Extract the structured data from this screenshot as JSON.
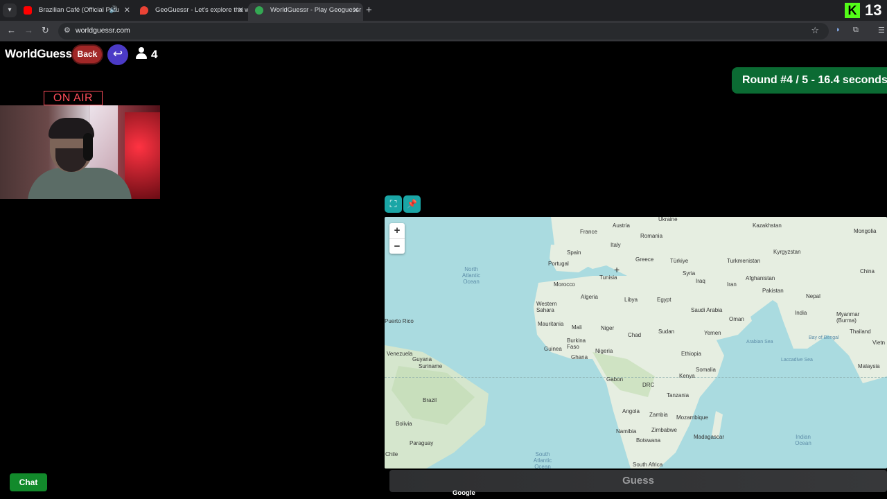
{
  "browser": {
    "tabs": [
      {
        "title": "Brazilian Café (Official Putu",
        "favicon": "youtube-icon",
        "color": "#ff0000"
      },
      {
        "title": "GeoGuessr - Let's explore the w",
        "favicon": "map-pin-icon",
        "color": "#ea4335"
      },
      {
        "title": "WorldGuessr - Play Geoguessr",
        "favicon": "globe-icon",
        "color": "#34a853"
      }
    ],
    "url": "worldguessr.com",
    "kick_count": "13",
    "kick_glyph": "K"
  },
  "game": {
    "title": "WorldGuessr",
    "back_label": "Back",
    "return_glyph": "↩",
    "player_count": "4",
    "round_text": "Round #4 / 5 - 16.4 seconds"
  },
  "webcam": {
    "on_air": "ON AIR"
  },
  "map": {
    "zoom_in": "+",
    "zoom_out": "−",
    "fullscreen_glyph": "⛶",
    "pin_glyph": "📌",
    "labels": {
      "ukraine": "Ukraine",
      "kazakhstan": "Kazakhstan",
      "mongolia": "Mongolia",
      "france": "France",
      "austria": "Austria",
      "romania": "Romania",
      "italy": "Italy",
      "spain": "Spain",
      "portugal": "Portugal",
      "greece": "Greece",
      "turkiye": "Türkiye",
      "turkmenistan": "Turkmenistan",
      "kyrgyzstan": "Kyrgyzstan",
      "china": "China",
      "north_atlantic": "North Atlantic Ocean",
      "tunisia": "Tunisia",
      "syria": "Syria",
      "iraq": "Iraq",
      "iran": "Iran",
      "afghanistan": "Afghanistan",
      "pakistan": "Pakistan",
      "morocco": "Morocco",
      "algeria": "Algeria",
      "libya": "Libya",
      "egypt": "Egypt",
      "saudi_arabia": "Saudi Arabia",
      "oman": "Oman",
      "nepal": "Nepal",
      "india": "India",
      "myanmar": "Myanmar (Burma)",
      "western_sahara": "Western Sahara",
      "puerto_rico": "Puerto Rico",
      "mauritania": "Mauritania",
      "mali": "Mali",
      "niger": "Niger",
      "chad": "Chad",
      "sudan": "Sudan",
      "yemen": "Yemen",
      "arabian_sea": "Arabian Sea",
      "bay_of_bengal": "Bay of Bengal",
      "thailand": "Thailand",
      "vietnam": "Vietn",
      "burkina_faso": "Burkina Faso",
      "guinea": "Guinea",
      "nigeria": "Nigeria",
      "ghana": "Ghana",
      "ethiopia": "Ethiopia",
      "venezuela": "Venezuela",
      "guyana": "Guyana",
      "suriname": "Suriname",
      "somalia": "Somalia",
      "laccadive_sea": "Laccadive Sea",
      "malaysia": "Malaysia",
      "gabon": "Gabon",
      "kenya": "Kenya",
      "drc": "DRC",
      "tanzania": "Tanzania",
      "brazil": "Brazil",
      "bolivia": "Bolivia",
      "angola": "Angola",
      "zambia": "Zambia",
      "mozambique": "Mozambique",
      "paraguay": "Paraguay",
      "namibia": "Namibia",
      "zimbabwe": "Zimbabwe",
      "madagascar": "Madagascar",
      "botswana": "Botswana",
      "indian_ocean": "Indian Ocean",
      "south_atlantic": "South Atlantic Ocean",
      "chile": "Chile",
      "south_africa": "South Africa"
    },
    "land_color": "#e6eee1",
    "water_color": "#aadbe0"
  },
  "guess_label": "Guess",
  "google_label": "Google",
  "chat_label": "Chat"
}
